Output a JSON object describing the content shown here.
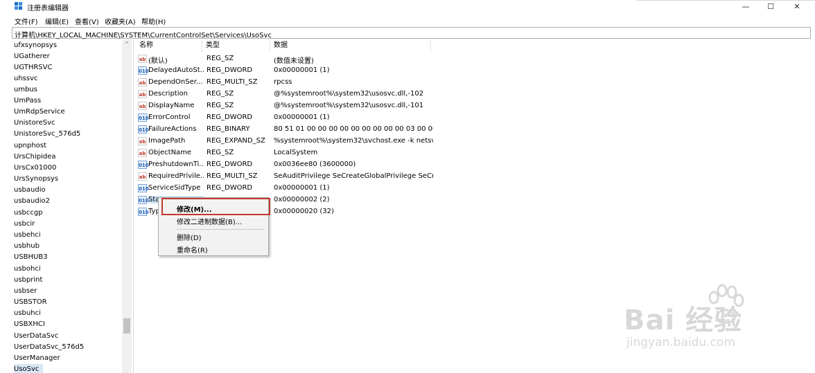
{
  "window": {
    "title": "注册表编辑器",
    "minimize": "—",
    "maximize": "☐",
    "close": "✕"
  },
  "menu": [
    "文件(F)",
    "编辑(E)",
    "查看(V)",
    "收藏夹(A)",
    "帮助(H)"
  ],
  "address": "计算机\\HKEY_LOCAL_MACHINE\\SYSTEM\\CurrentControlSet\\Services\\UsoSvc",
  "tree": {
    "items": [
      "ufxsynopsys",
      "UGatherer",
      "UGTHRSVC",
      "uhssvc",
      "umbus",
      "UmPass",
      "UmRdpService",
      "UnistoreSvc",
      "UnistoreSvc_576d5",
      "upnphost",
      "UrsChipidea",
      "UrsCx01000",
      "UrsSynopsys",
      "usbaudio",
      "usbaudio2",
      "usbccgp",
      "usbcir",
      "usbehci",
      "usbhub",
      "USBHUB3",
      "usbohci",
      "usbprint",
      "usbser",
      "USBSTOR",
      "usbuhci",
      "USBXHCI",
      "UserDataSvc",
      "UserDataSvc_576d5",
      "UserManager",
      "UsoSvc"
    ],
    "selected": "UsoSvc",
    "scroll_up": "^"
  },
  "columns": {
    "name": "名称",
    "type": "类型",
    "data": "数据"
  },
  "values": [
    {
      "icon": "ab",
      "name": "(默认)",
      "type": "REG_SZ",
      "data": "(数值未设置)"
    },
    {
      "icon": "010",
      "name": "DelayedAutoSt...",
      "type": "REG_DWORD",
      "data": "0x00000001 (1)"
    },
    {
      "icon": "ab",
      "name": "DependOnSer...",
      "type": "REG_MULTI_SZ",
      "data": "rpcss"
    },
    {
      "icon": "ab",
      "name": "Description",
      "type": "REG_SZ",
      "data": "@%systemroot%\\system32\\usosvc.dll,-102"
    },
    {
      "icon": "ab",
      "name": "DisplayName",
      "type": "REG_SZ",
      "data": "@%systemroot%\\system32\\usosvc.dll,-101"
    },
    {
      "icon": "010",
      "name": "ErrorControl",
      "type": "REG_DWORD",
      "data": "0x00000001 (1)"
    },
    {
      "icon": "010",
      "name": "FailureActions",
      "type": "REG_BINARY",
      "data": "80 51 01 00 00 00 00 00 00 00 00 00 03 00 00..."
    },
    {
      "icon": "ab",
      "name": "ImagePath",
      "type": "REG_EXPAND_SZ",
      "data": "%systemroot%\\system32\\svchost.exe -k netsv..."
    },
    {
      "icon": "ab",
      "name": "ObjectName",
      "type": "REG_SZ",
      "data": "LocalSystem"
    },
    {
      "icon": "010",
      "name": "PreshutdownTi...",
      "type": "REG_DWORD",
      "data": "0x0036ee80 (3600000)"
    },
    {
      "icon": "ab",
      "name": "RequiredPrivile...",
      "type": "REG_MULTI_SZ",
      "data": "SeAuditPrivilege SeCreateGlobalPrivilege SeCr..."
    },
    {
      "icon": "010",
      "name": "ServiceSidType",
      "type": "REG_DWORD",
      "data": "0x00000001 (1)"
    },
    {
      "icon": "010",
      "name": "Sta",
      "type": "",
      "data": "0x00000002 (2)"
    },
    {
      "icon": "010",
      "name": "Typ",
      "type": "",
      "data": "0x00000020 (32)"
    }
  ],
  "context_menu": {
    "modify": "修改(M)...",
    "modify_binary": "修改二进制数据(B)...",
    "delete": "删除(D)",
    "rename": "重命名(R)"
  },
  "watermark": {
    "brand": "Bai  经验",
    "url": "jingyan.baidu.com",
    "accent": "#c0392b"
  }
}
